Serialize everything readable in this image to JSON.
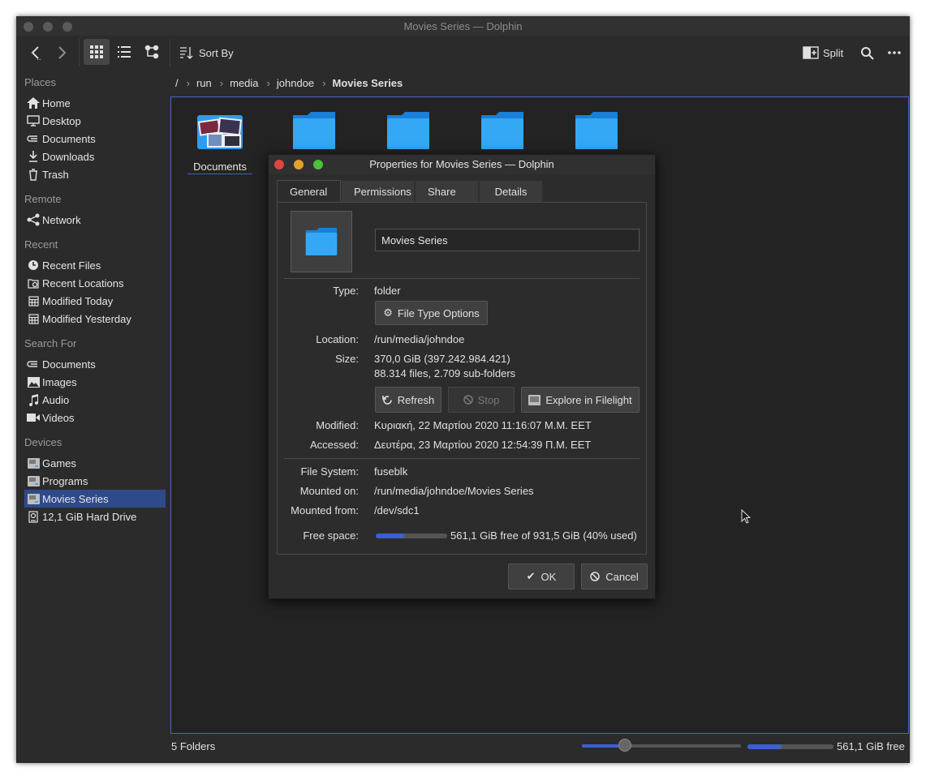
{
  "window": {
    "title": "Movies Series — Dolphin"
  },
  "toolbar": {
    "sort_label": "Sort By",
    "split_label": "Split"
  },
  "sidebar": {
    "places_header": "Places",
    "places": [
      {
        "label": "Home",
        "icon": "home-icon"
      },
      {
        "label": "Desktop",
        "icon": "desktop-icon"
      },
      {
        "label": "Documents",
        "icon": "documents-icon"
      },
      {
        "label": "Downloads",
        "icon": "downloads-icon"
      },
      {
        "label": "Trash",
        "icon": "trash-icon"
      }
    ],
    "remote_header": "Remote",
    "remote": [
      {
        "label": "Network",
        "icon": "network-icon"
      }
    ],
    "recent_header": "Recent",
    "recent": [
      {
        "label": "Recent Files",
        "icon": "clock-icon"
      },
      {
        "label": "Recent Locations",
        "icon": "recent-locations-icon"
      },
      {
        "label": "Modified Today",
        "icon": "calendar-icon"
      },
      {
        "label": "Modified Yesterday",
        "icon": "calendar-icon"
      }
    ],
    "search_header": "Search For",
    "search": [
      {
        "label": "Documents",
        "icon": "documents-icon"
      },
      {
        "label": "Images",
        "icon": "image-icon"
      },
      {
        "label": "Audio",
        "icon": "music-icon"
      },
      {
        "label": "Videos",
        "icon": "video-icon"
      }
    ],
    "devices_header": "Devices",
    "devices": [
      {
        "label": "Games",
        "icon": "drive-icon"
      },
      {
        "label": "Programs",
        "icon": "drive-icon"
      },
      {
        "label": "Movies Series",
        "icon": "drive-icon",
        "selected": true
      },
      {
        "label": "12,1 GiB Hard Drive",
        "icon": "harddisk-icon"
      }
    ]
  },
  "breadcrumb": {
    "root": "/",
    "parts": [
      "run",
      "media",
      "johndoe"
    ],
    "current": "Movies Series"
  },
  "view": {
    "first_item_label": "Documents"
  },
  "status": {
    "folders": "5 Folders",
    "free": "561,1 GiB free",
    "zoom_fraction": 0.27,
    "space_used_fraction": 0.4
  },
  "dialog": {
    "title": "Properties for Movies Series — Dolphin",
    "tabs": [
      "General",
      "Permissions",
      "Share",
      "Details"
    ],
    "name_value": "Movies Series",
    "type_label": "Type:",
    "type_value": "folder",
    "file_type_options": "File Type Options",
    "location_label": "Location:",
    "location_value": "/run/media/johndoe",
    "size_label": "Size:",
    "size_value": "370,0 GiB (397.242.984.421)",
    "size_counts": "88.314 files, 2.709 sub-folders",
    "refresh": "Refresh",
    "stop": "Stop",
    "explore": "Explore in Filelight",
    "modified_label": "Modified:",
    "modified_value": "Κυριακή, 22 Μαρτίου 2020 11:16:07 Μ.Μ. EET",
    "accessed_label": "Accessed:",
    "accessed_value": "Δευτέρα, 23 Μαρτίου 2020 12:54:39 Π.Μ. EET",
    "fs_label": "File System:",
    "fs_value": "fuseblk",
    "mounted_on_label": "Mounted on:",
    "mounted_on_value": "/run/media/johndoe/Movies Series",
    "mounted_from_label": "Mounted from:",
    "mounted_from_value": "/dev/sdc1",
    "free_label": "Free space:",
    "free_value": "561,1 GiB free of 931,5 GiB (40% used)",
    "free_fraction_used": 0.4,
    "ok": "OK",
    "cancel": "Cancel"
  },
  "colors": {
    "accent": "#3d5fd1",
    "selection": "#2f4a8a",
    "folder": "#2d9cf0"
  }
}
